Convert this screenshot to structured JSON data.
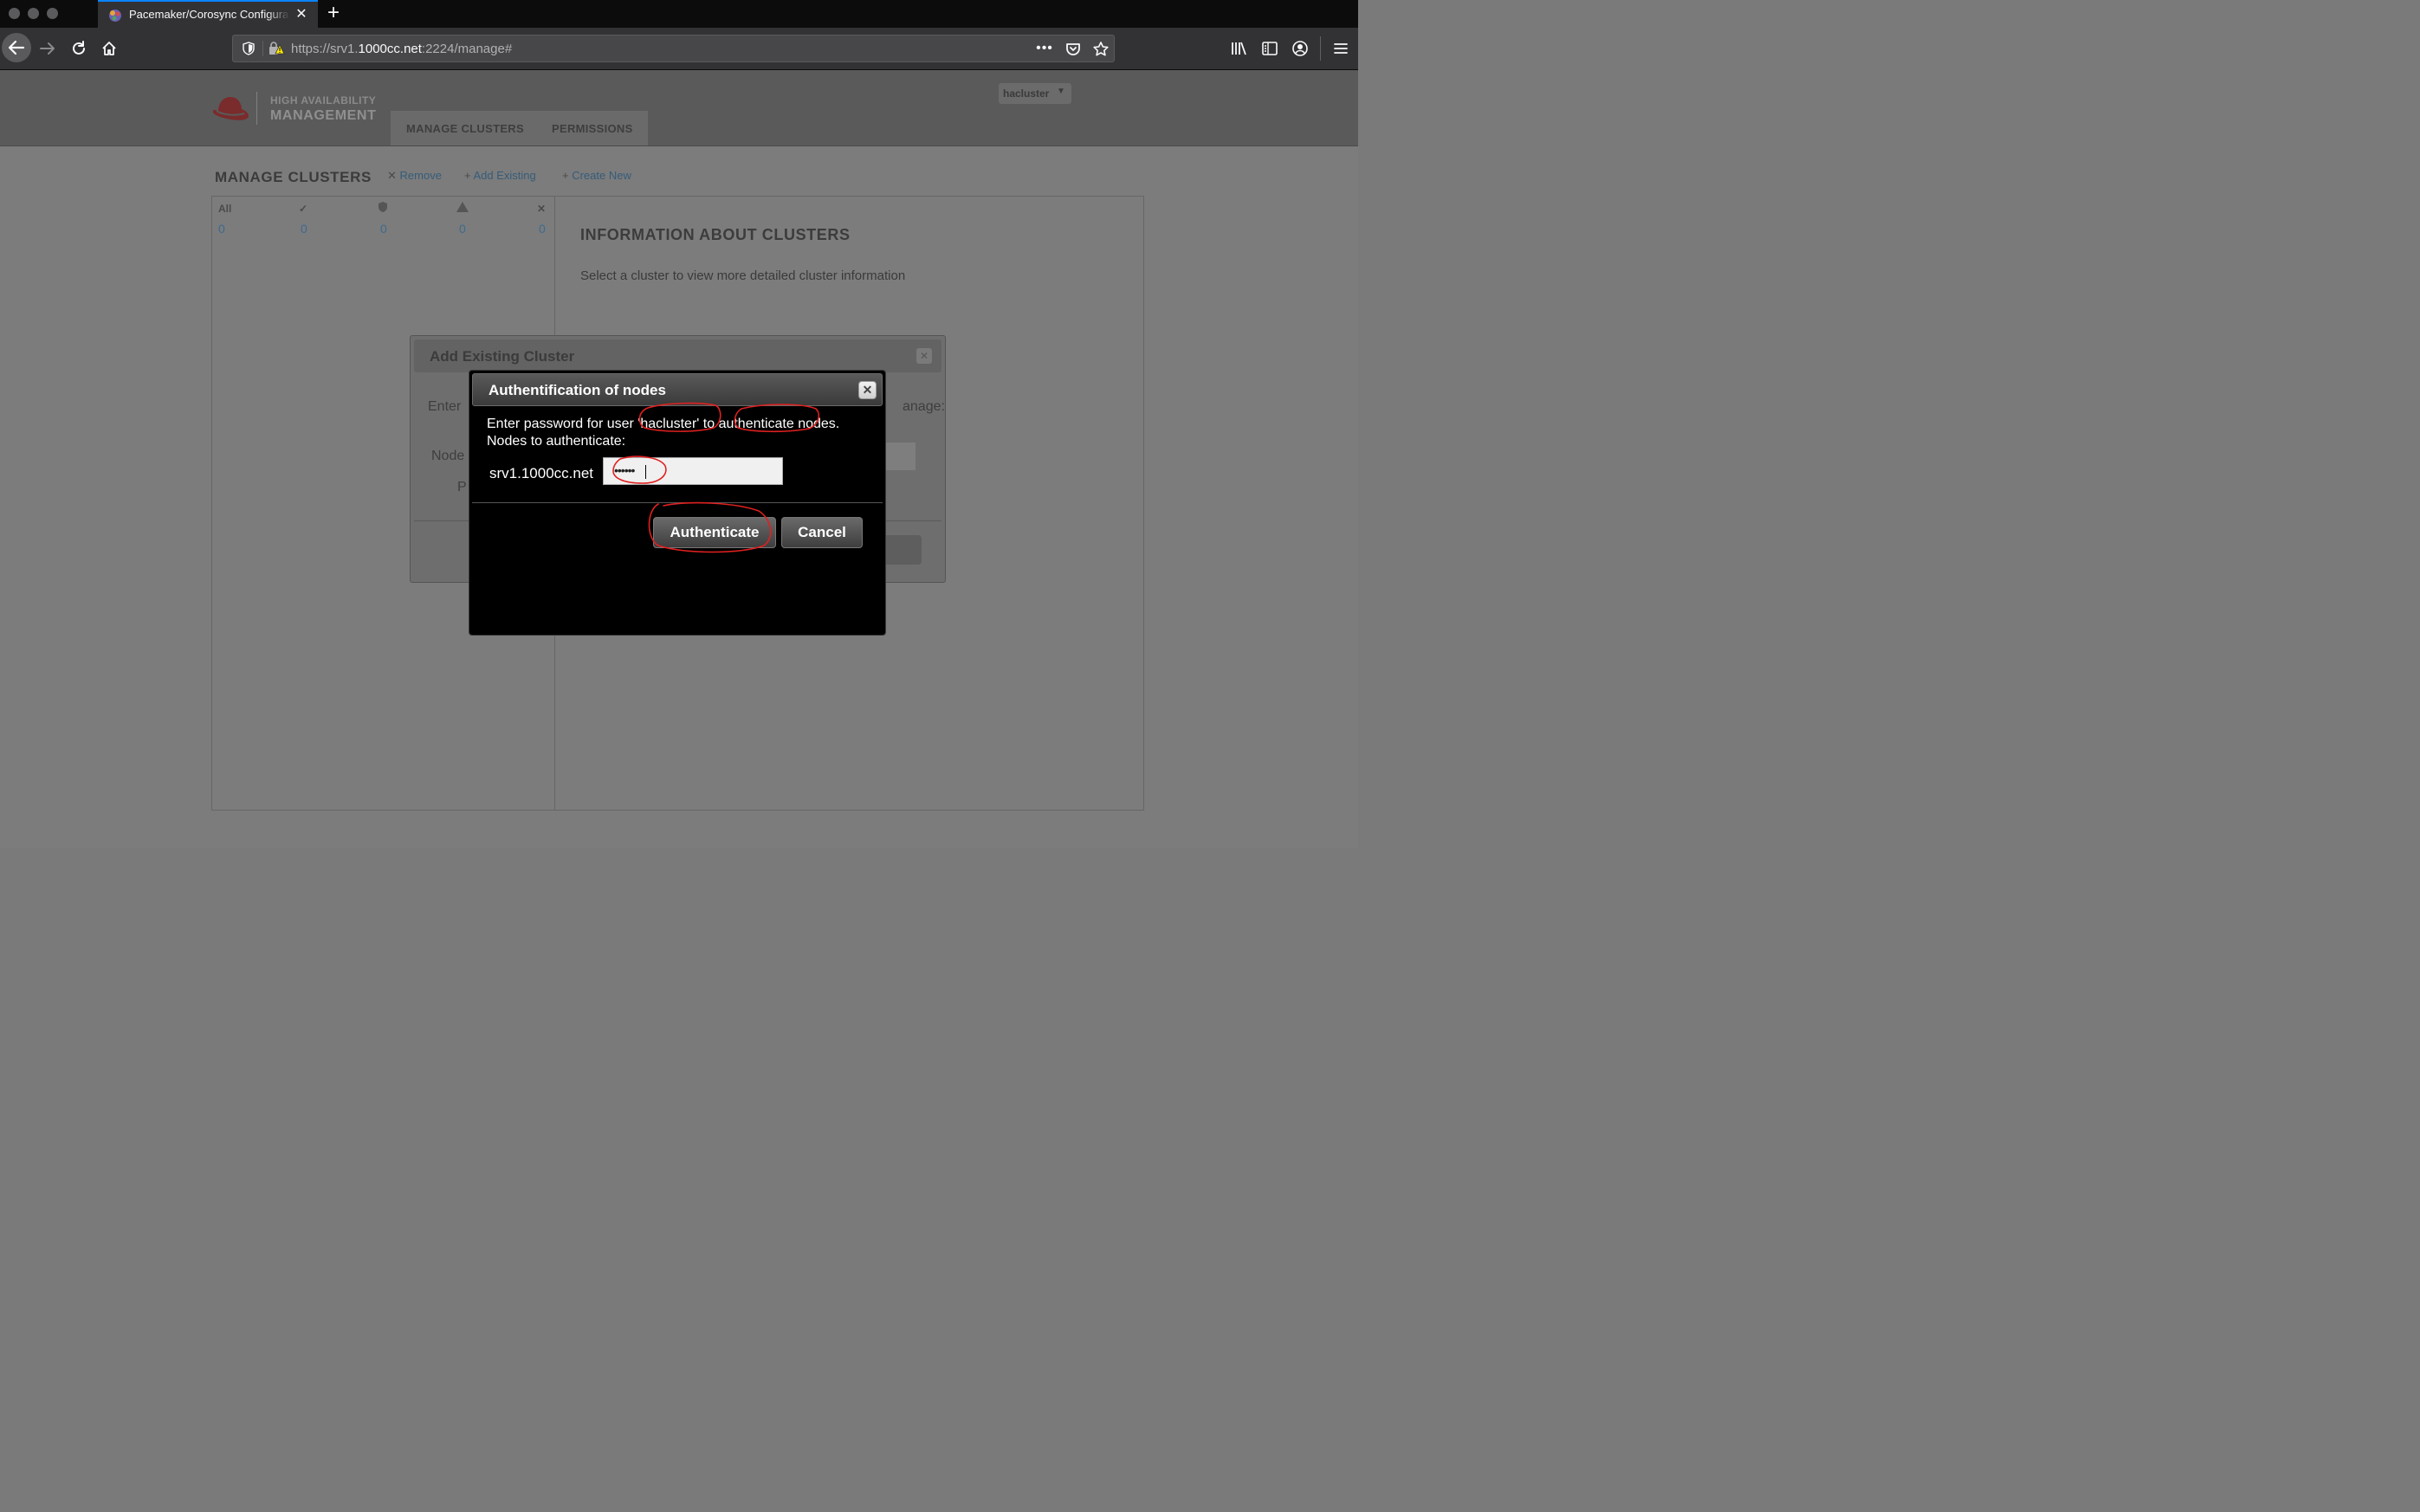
{
  "browser": {
    "tab_title": "Pacemaker/Corosync Configuration",
    "url_prefix": "https://srv1.",
    "url_host": "1000cc.net",
    "url_suffix": ":2224/manage#"
  },
  "header": {
    "logo_line1": "HIGH AVAILABILITY",
    "logo_line2": "MANAGEMENT",
    "nav_manage": "MANAGE CLUSTERS",
    "nav_permissions": "PERMISSIONS",
    "user": "hacluster"
  },
  "main": {
    "title": "MANAGE CLUSTERS",
    "actions": [
      "Remove",
      "Add Existing",
      "Create New"
    ],
    "filter_all_label": "All",
    "counts": [
      "0",
      "0",
      "0",
      "0",
      "0"
    ],
    "info_title": "INFORMATION ABOUT CLUSTERS",
    "info_text": "Select a cluster to view more detailed cluster information"
  },
  "add_existing_dialog": {
    "title": "Add Existing Cluster",
    "frag_enter": "Enter",
    "frag_node": "Node",
    "frag_p": "P",
    "frag_manage": "anage:",
    "frag_cancel": "cel"
  },
  "auth_dialog": {
    "title": "Authentification of nodes",
    "message_line1": "Enter password for user 'hacluster' to authenticate nodes.",
    "message_line2": "Nodes to authenticate:",
    "node_name": "srv1.1000cc.net",
    "password_mask": "••••••",
    "authenticate_label": "Authenticate",
    "cancel_label": "Cancel"
  },
  "colors": {
    "annotation": "#e02020",
    "tab_accent": "#0a84ff"
  }
}
